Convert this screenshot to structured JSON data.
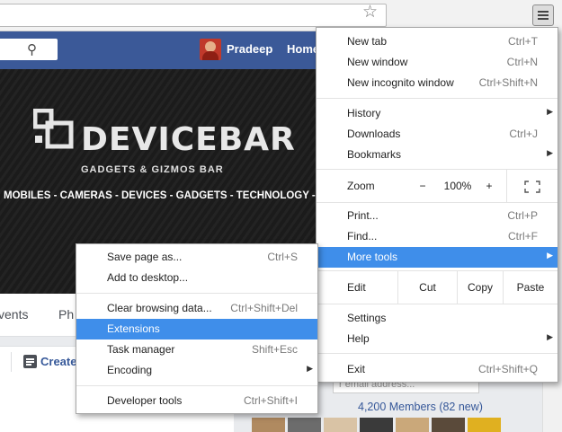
{
  "browser": {
    "star_icon": "star-outline-icon",
    "menu_icon": "hamburger-menu-icon"
  },
  "facebook": {
    "search_icon": "search-icon",
    "profile_name": "Pradeep",
    "home_label": "Home"
  },
  "cover": {
    "brand": "DEVICEBAR",
    "tagline": "GADGETS & GIZMOS BAR",
    "topics": "MOBILES - CAMERAS - DEVICES - GADGETS - TECHNOLOGY - ELECTRO"
  },
  "page_tabs": {
    "events": "vents",
    "photos": "Ph"
  },
  "create": {
    "label": "Create"
  },
  "sidebar": {
    "email_placeholder": "r email address...",
    "members": "4,200 Members (82 new)"
  },
  "chrome_menu": {
    "new_tab": {
      "label": "New tab",
      "shortcut": "Ctrl+T"
    },
    "new_window": {
      "label": "New window",
      "shortcut": "Ctrl+N"
    },
    "new_incognito": {
      "label": "New incognito window",
      "shortcut": "Ctrl+Shift+N"
    },
    "history": {
      "label": "History"
    },
    "downloads": {
      "label": "Downloads",
      "shortcut": "Ctrl+J"
    },
    "bookmarks": {
      "label": "Bookmarks"
    },
    "zoom": {
      "label": "Zoom",
      "minus": "−",
      "value": "100%",
      "plus": "+"
    },
    "fullscreen_icon": "fullscreen-icon",
    "print": {
      "label": "Print...",
      "shortcut": "Ctrl+P"
    },
    "find": {
      "label": "Find...",
      "shortcut": "Ctrl+F"
    },
    "more_tools": {
      "label": "More tools"
    },
    "edit": {
      "label": "Edit",
      "cut": "Cut",
      "copy": "Copy",
      "paste": "Paste"
    },
    "settings": {
      "label": "Settings"
    },
    "help": {
      "label": "Help"
    },
    "exit": {
      "label": "Exit",
      "shortcut": "Ctrl+Shift+Q"
    }
  },
  "more_tools_menu": {
    "save_page": {
      "label": "Save page as...",
      "shortcut": "Ctrl+S"
    },
    "add_desktop": {
      "label": "Add to desktop..."
    },
    "clear_data": {
      "label": "Clear browsing data...",
      "shortcut": "Ctrl+Shift+Del"
    },
    "extensions": {
      "label": "Extensions"
    },
    "task_manager": {
      "label": "Task manager",
      "shortcut": "Shift+Esc"
    },
    "encoding": {
      "label": "Encoding"
    },
    "dev_tools": {
      "label": "Developer tools",
      "shortcut": "Ctrl+Shift+I"
    }
  },
  "colors": {
    "facebook_blue": "#3b5998",
    "menu_highlight": "#3f8eea"
  }
}
